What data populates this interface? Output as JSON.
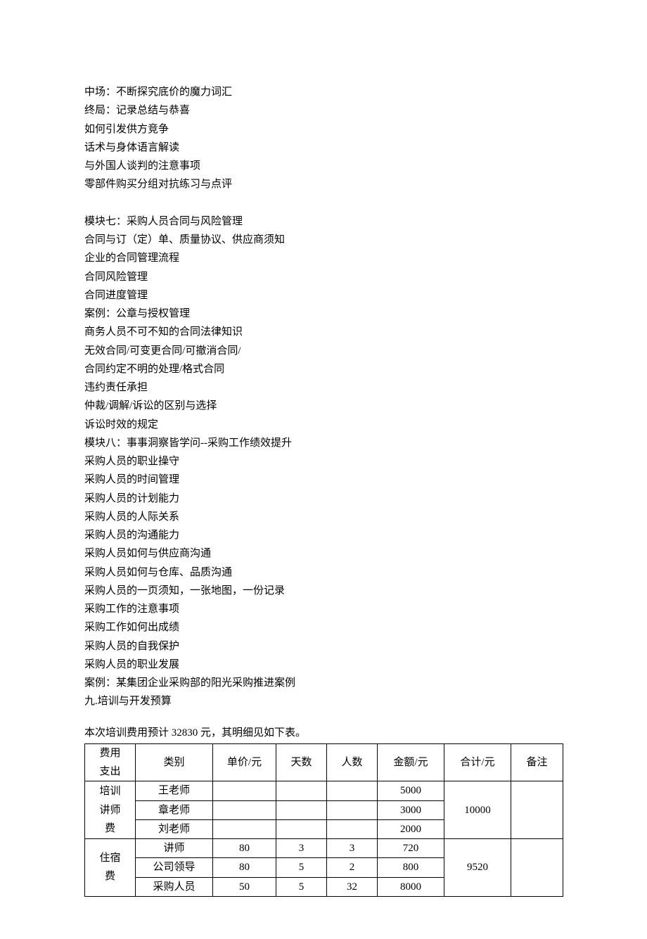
{
  "lines_block1": [
    "中场：不断探究底价的魔力词汇",
    "终局：记录总结与恭喜",
    "如何引发供方竞争",
    "话术与身体语言解读",
    "与外国人谈判的注意事项",
    "零部件购买分组对抗练习与点评"
  ],
  "lines_block2": [
    "模块七：采购人员合同与风险管理",
    "合同与订（定）单、质量协议、供应商须知",
    "企业的合同管理流程",
    "合同风险管理",
    "合同进度管理",
    "案例：公章与授权管理",
    "商务人员不可不知的合同法律知识",
    "无效合同/可变更合同/可撤消合同/",
    "合同约定不明的处理/格式合同",
    "违约责任承担",
    "仲裁/调解/诉讼的区别与选择",
    "诉讼时效的规定",
    "模块八：事事洞察皆学问--采购工作绩效提升",
    "采购人员的职业操守",
    "采购人员的时间管理",
    "采购人员的计划能力",
    "采购人员的人际关系",
    "采购人员的沟通能力",
    "采购人员如何与供应商沟通",
    "采购人员如何与仓库、品质沟通",
    "采购人员的一页须知，一张地图，一份记录",
    "采购工作的注意事项",
    "采购工作如何出成绩",
    "采购人员的自我保护",
    "采购人员的职业发展",
    "案例：某集团企业采购部的阳光采购推进案例",
    "九.培训与开发预算"
  ],
  "budget_summary": "本次培训费用预计 32830 元，其明细见如下表。",
  "table": {
    "headers": {
      "c0a": "费用",
      "c0b": "支出",
      "c1": "类别",
      "c2": "单价/元",
      "c3": "天数",
      "c4": "人数",
      "c5": "金额/元",
      "c6": "合计/元",
      "c7": "备注"
    },
    "groups": [
      {
        "labelA": "培训",
        "labelB": "讲师",
        "labelC": "费",
        "subtotal": "10000",
        "rows": [
          {
            "cat": "王老师",
            "unit": "",
            "days": "",
            "ppl": "",
            "amount": "5000"
          },
          {
            "cat": "章老师",
            "unit": "",
            "days": "",
            "ppl": "",
            "amount": "3000"
          },
          {
            "cat": "刘老师",
            "unit": "",
            "days": "",
            "ppl": "",
            "amount": "2000"
          }
        ]
      },
      {
        "labelA": "住宿",
        "labelB": "费",
        "labelC": "",
        "subtotal": "9520",
        "rows": [
          {
            "cat": "讲师",
            "unit": "80",
            "days": "3",
            "ppl": "3",
            "amount": "720"
          },
          {
            "cat": "公司领导",
            "unit": "80",
            "days": "5",
            "ppl": "2",
            "amount": "800"
          },
          {
            "cat": "采购人员",
            "unit": "50",
            "days": "5",
            "ppl": "32",
            "amount": "8000"
          }
        ]
      }
    ]
  }
}
